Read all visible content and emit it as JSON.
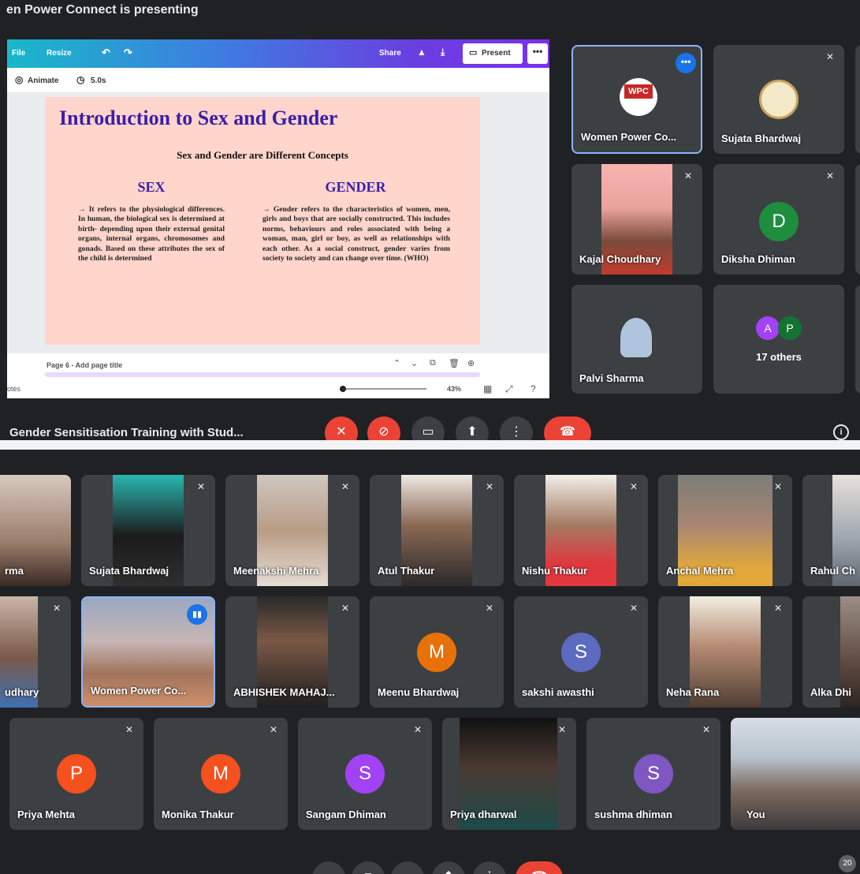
{
  "top": {
    "banner": "en Power Connect is presenting",
    "meeting_title": "Gender Sensitisation Training with Stud...",
    "canva": {
      "file": "File",
      "resize": "Resize",
      "share": "Share",
      "present": "Present",
      "more": "•••",
      "animate": "Animate",
      "duration": "5.0s",
      "page_label": "Page 6 - Add page title",
      "notes": "otes",
      "zoom": "43%"
    },
    "slide": {
      "title": "Introduction to Sex and Gender",
      "subtitle": "Sex and Gender are Different Concepts",
      "sex_heading": "SEX",
      "sex_text": "→ It refers to the physiological differences. In human, the biological sex is determined at birth- depending upon their external genital organs, internal organs, chromosomes and gonads. Based on these attributes the sex of the child is determined",
      "gender_heading": "GENDER",
      "gender_text": "→ Gender refers to the characteristics of women, men, girls and boys that are socially constructed. This includes norms, behaviours and roles associated with being a woman, man, girl or boy, as well as relationships with each other. As a social construct, gender varies from society to society and can change over time. (WHO)"
    },
    "participants": [
      {
        "name": "Women Power Co...",
        "type": "logo"
      },
      {
        "name": "Sujata Bhardwaj",
        "type": "logo2"
      },
      {
        "name": "Kajal Choudhary",
        "type": "video"
      },
      {
        "name": "Diksha Dhiman",
        "initial": "D",
        "color": "#1e8e3e"
      },
      {
        "name": "Palvi Sharma",
        "type": "buddha"
      },
      {
        "name": "17 others",
        "initials": [
          "A",
          "P"
        ],
        "colors": [
          "#a142f4",
          "#137333"
        ]
      }
    ]
  },
  "bottom": {
    "row1": [
      "rma",
      "Sujata Bhardwaj",
      "Meenakshi Mehra",
      "Atul Thakur",
      "Nishu Thakur",
      "Anchal Mehra",
      "Rahul Ch"
    ],
    "row2": [
      {
        "name": "udhary"
      },
      {
        "name": "Women Power Co..."
      },
      {
        "name": "ABHISHEK MAHAJ..."
      },
      {
        "name": "Meenu Bhardwaj",
        "initial": "M",
        "color": "#e8710a"
      },
      {
        "name": "sakshi awasthi",
        "initial": "S",
        "color": "#5c6bc0"
      },
      {
        "name": "Neha Rana"
      },
      {
        "name": "Alka Dhi"
      }
    ],
    "row3": [
      {
        "name": "Priya Mehta",
        "initial": "P",
        "color": "#f4511e"
      },
      {
        "name": "Monika Thakur",
        "initial": "M",
        "color": "#f4511e"
      },
      {
        "name": "Sangam Dhiman",
        "initial": "S",
        "color": "#a142f4"
      },
      {
        "name": "Priya dharwal"
      },
      {
        "name": "sushma dhiman",
        "initial": "S",
        "color": "#7e57c2"
      },
      {
        "name": "You"
      }
    ],
    "badge": "20"
  }
}
